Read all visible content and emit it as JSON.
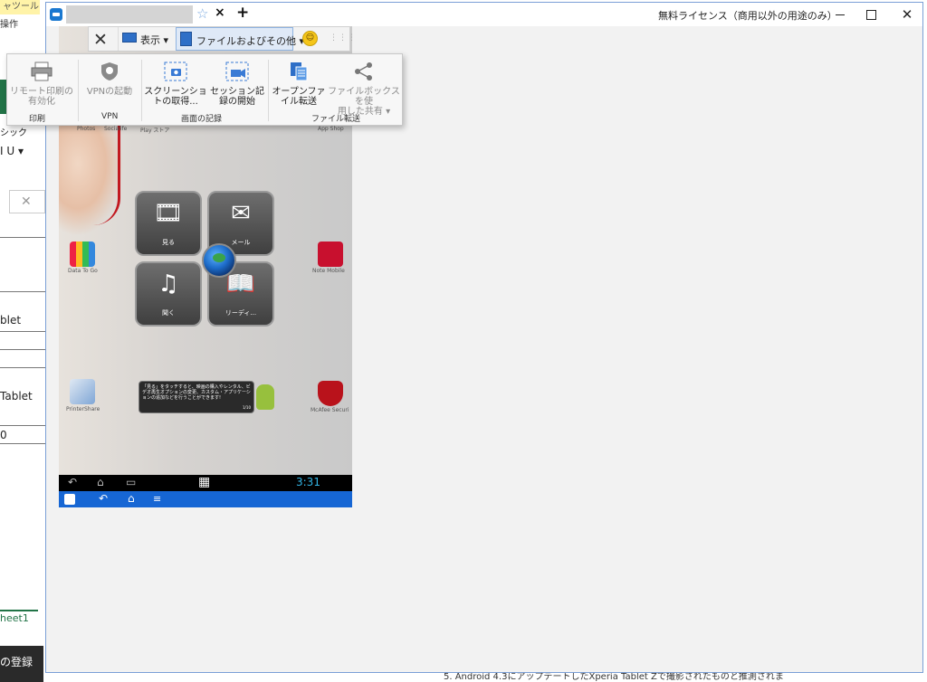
{
  "excel": {
    "ribbon_tab": "ャツール",
    "ribbon_sub": "操作",
    "font_name": "シック",
    "format_buttons": "I U ▾",
    "namebox_icon": "✕",
    "cells": [
      "blet",
      "Tablet",
      "0"
    ],
    "sheet_tab": "heet1",
    "taskbar_text": "の登録"
  },
  "bottom_doc_text": "5. Android 4.3にアップデートしたXperia Tablet Zで撮影されたものと推測されま",
  "window": {
    "license_text": "無料ライセンス（商用以外の用途のみ）",
    "close_glyph": "✕"
  },
  "tab": {
    "star": "☆",
    "close": "×",
    "add": "+"
  },
  "toolbar": {
    "close_glyph": "✕",
    "view_label": "表示 ▾",
    "files_label": "ファイルおよびその他 ▾",
    "smiley": "☺",
    "grip": "⋮⋮⋮"
  },
  "ribbon": {
    "buttons": [
      {
        "label": "リモート印刷の\n有効化",
        "icon": "printer-icon"
      },
      {
        "label": "VPNの起動",
        "icon": "vpn-shield-icon"
      },
      {
        "label": "スクリーンショ\nトの取得...",
        "icon": "screenshot-camera-icon"
      },
      {
        "label": "セッション記\n録の開始",
        "icon": "record-video-icon"
      },
      {
        "label": "オープンファ\nイル転送",
        "icon": "file-transfer-icon"
      },
      {
        "label": "ファイルボックスを使\n用した共有 ▾",
        "icon": "share-icon"
      }
    ],
    "groups": [
      "印刷",
      "VPN",
      "画面の記録",
      "ファイル転送"
    ]
  },
  "remote": {
    "app_labels": [
      "Photos",
      "Socialife",
      "Play ストア",
      "App Shop",
      "Data To Go",
      "Note Mobile",
      "PrinterShare",
      "McAfee Securi"
    ],
    "tiles": [
      {
        "label": "見る",
        "icon": "film-icon"
      },
      {
        "label": "メール",
        "icon": "mail-icon"
      },
      {
        "label": "聞く",
        "icon": "music-note-icon"
      },
      {
        "label": "リーディ...",
        "icon": "book-icon"
      }
    ],
    "toast_text": "「見る」をタッチすると、映画の購入やレンタル、ビデオ再生オプションの変更、カスタム・アプリケーションの追加などを行うことができます!",
    "toast_page": "1/10",
    "clock": "3:31",
    "nav_back": "↶",
    "nav_home": "⌂",
    "nav_recent": "▭",
    "apps_grid": "▦"
  },
  "colors": {
    "accent_blue": "#1666d4",
    "title_border": "#7a9fd6",
    "android_clock": "#33b5e5",
    "excel_green": "#217346"
  }
}
